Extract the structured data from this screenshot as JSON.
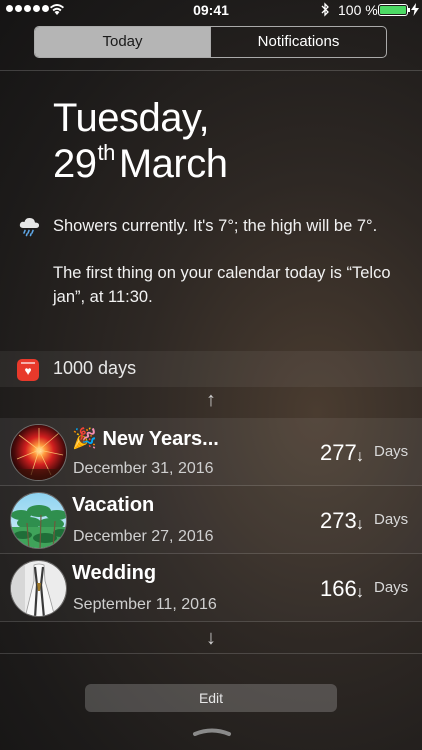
{
  "status_bar": {
    "time": "09:41",
    "battery_percent": "100 %",
    "battery_level": 1.0,
    "battery_color": "#4cd964",
    "signal_icon": "signal-dots-icon",
    "wifi_icon": "wifi-icon",
    "bluetooth_icon": "bluetooth-icon",
    "charging_icon": "charging-bolt-icon"
  },
  "tabs": [
    {
      "label": "Today",
      "active": true
    },
    {
      "label": "Notifications",
      "active": false
    }
  ],
  "date": {
    "weekday": "Tuesday,",
    "day": "29",
    "day_suffix": "th",
    "month": "March"
  },
  "summary": {
    "weather_icon": "rain-cloud-icon",
    "weather_text": "Showers currently. It's 7°; the high will be 7°.",
    "calendar_text": "The first thing on your calendar today is “Telco jan”, at 11:30."
  },
  "widget": {
    "app_icon": "calendar-app-icon",
    "app_icon_text": "♥",
    "app_icon_color": "#e8392b",
    "title": "1000 days",
    "scroll_up_icon": "↑",
    "scroll_down_icon": "↓",
    "events": [
      {
        "emoji": "🎉",
        "name": "New Years...",
        "date": "December 31, 2016",
        "count": "277",
        "direction": "↓",
        "unit": "Days",
        "avatar": "fireworks-photo"
      },
      {
        "emoji": "",
        "name": "Vacation",
        "date": "December 27, 2016",
        "count": "273",
        "direction": "↓",
        "unit": "Days",
        "avatar": "palm-trees-photo"
      },
      {
        "emoji": "",
        "name": "Wedding",
        "date": "September 11, 2016",
        "count": "166",
        "direction": "↓",
        "unit": "Days",
        "avatar": "wedding-dress-photo"
      }
    ]
  },
  "edit_label": "Edit"
}
